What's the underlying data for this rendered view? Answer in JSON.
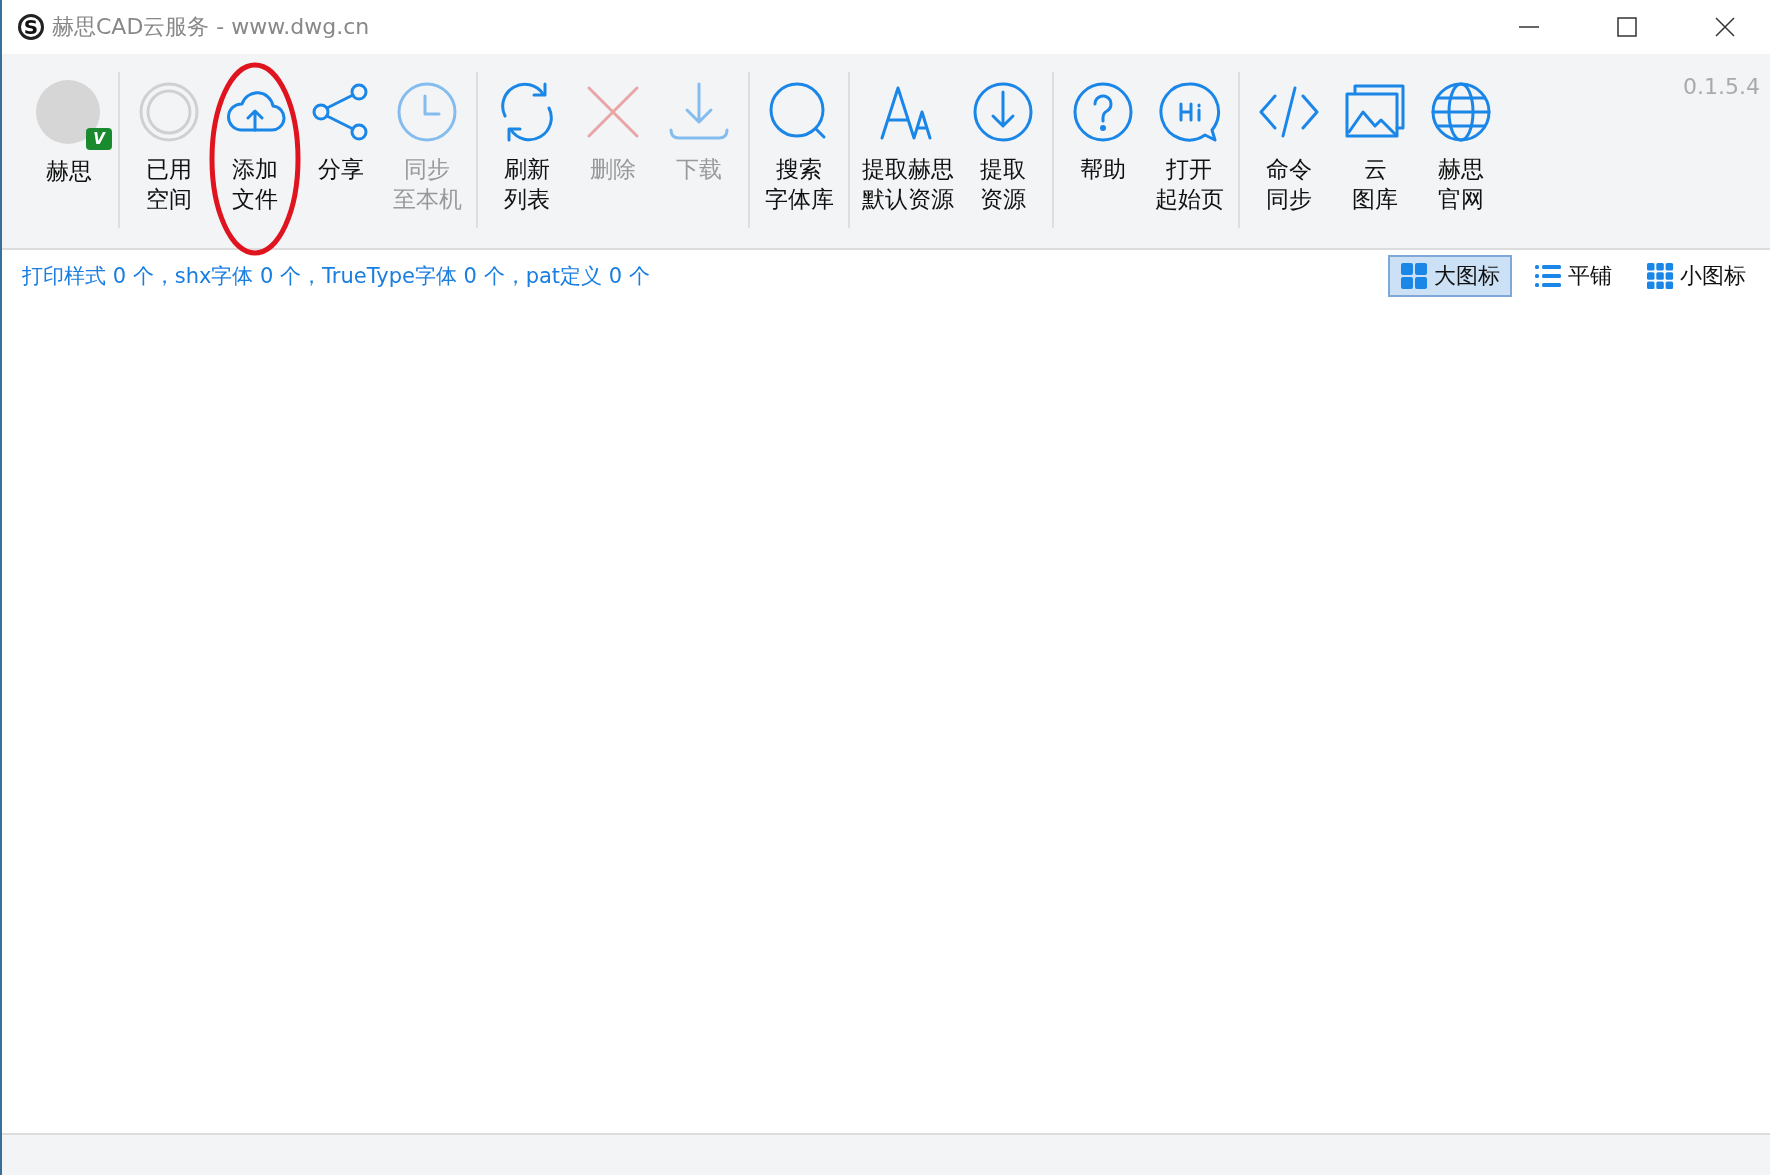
{
  "window": {
    "logo": "S",
    "title": "赫思CAD云服务 - www.dwg.cn"
  },
  "toolbar": {
    "version": "0.1.5.4",
    "groups": [
      {
        "items": [
          {
            "lines": [
              "赫思"
            ],
            "kind": "avatar",
            "badge": "V",
            "disabled": false,
            "highlighted": false
          }
        ]
      },
      {
        "items": [
          {
            "lines": [
              "已用",
              "空间"
            ],
            "kind": "button",
            "disabled": false,
            "highlighted": false
          },
          {
            "lines": [
              "添加",
              "文件"
            ],
            "kind": "button",
            "disabled": false,
            "highlighted": true
          },
          {
            "lines": [
              "分享"
            ],
            "kind": "button",
            "disabled": false,
            "highlighted": false
          },
          {
            "lines": [
              "同步",
              "至本机"
            ],
            "kind": "button",
            "disabled": true,
            "highlighted": false
          }
        ]
      },
      {
        "items": [
          {
            "lines": [
              "刷新",
              "列表"
            ],
            "kind": "button",
            "disabled": false,
            "highlighted": false
          },
          {
            "lines": [
              "删除"
            ],
            "kind": "button",
            "disabled": true,
            "highlighted": false
          },
          {
            "lines": [
              "下载"
            ],
            "kind": "button",
            "disabled": true,
            "highlighted": false
          }
        ]
      },
      {
        "items": [
          {
            "lines": [
              "搜索",
              "字体库"
            ],
            "kind": "button",
            "disabled": false,
            "highlighted": false
          }
        ]
      },
      {
        "items": [
          {
            "lines": [
              "提取赫思",
              "默认资源"
            ],
            "kind": "button",
            "disabled": false,
            "highlighted": false
          },
          {
            "lines": [
              "提取",
              "资源"
            ],
            "kind": "button",
            "disabled": false,
            "highlighted": false
          }
        ]
      },
      {
        "items": [
          {
            "lines": [
              "帮助"
            ],
            "kind": "button",
            "disabled": false,
            "highlighted": false
          },
          {
            "lines": [
              "打开",
              "起始页"
            ],
            "kind": "button",
            "disabled": false,
            "highlighted": false
          }
        ]
      },
      {
        "items": [
          {
            "lines": [
              "命令",
              "同步"
            ],
            "kind": "button",
            "disabled": false,
            "highlighted": false
          },
          {
            "lines": [
              "云",
              "图库"
            ],
            "kind": "button",
            "disabled": false,
            "highlighted": false
          },
          {
            "lines": [
              "赫思",
              "官网"
            ],
            "kind": "button",
            "disabled": false,
            "highlighted": false
          }
        ]
      }
    ]
  },
  "summary": "打印样式 0 个，shx字体 0 个，TrueType字体 0 个，pat定义 0 个",
  "views": [
    {
      "label": "大图标",
      "selected": true
    },
    {
      "label": "平铺",
      "selected": false
    },
    {
      "label": "小图标",
      "selected": false
    }
  ]
}
